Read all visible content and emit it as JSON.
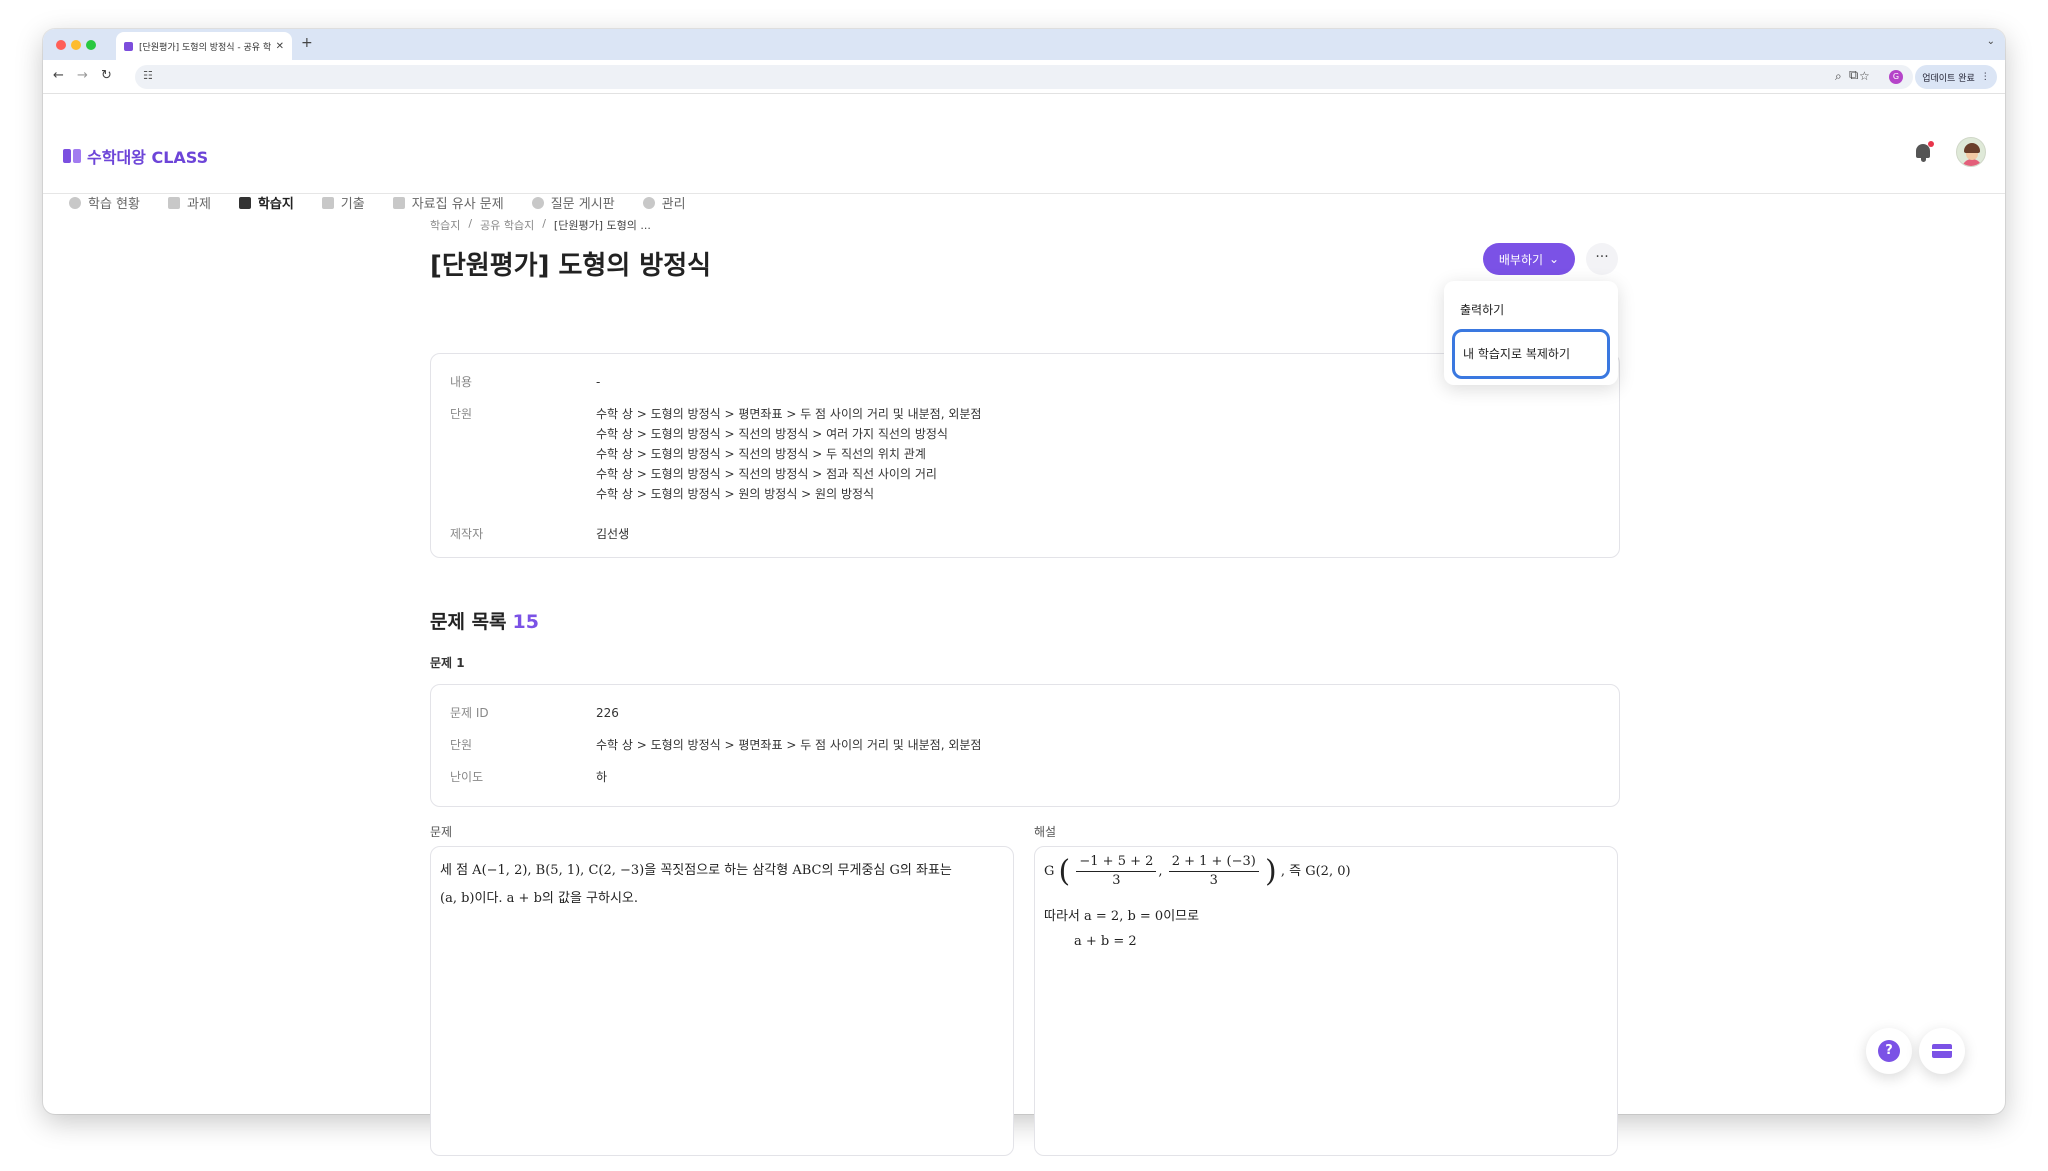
{
  "browser": {
    "tab_title": "[단원평가] 도형의 방정식 - 공유 학",
    "new_tab": "+",
    "update_label": "업데이트 완료",
    "profile_initial": "G",
    "tab_menu": "⌄"
  },
  "app": {
    "logo_text": "수학대왕 CLASS",
    "nav": [
      {
        "label": "학습 현황"
      },
      {
        "label": "과제"
      },
      {
        "label": "학습지"
      },
      {
        "label": "기출"
      },
      {
        "label": "자료집 유사 문제"
      },
      {
        "label": "질문 게시판"
      },
      {
        "label": "관리"
      }
    ]
  },
  "breadcrumb": [
    "학습지",
    "/",
    "공유 학습지",
    "/",
    "[단원평가] 도형의 ..."
  ],
  "page": {
    "title": "[단원평가] 도형의 방정식",
    "distribute_label": "배부하기",
    "more_label": "···"
  },
  "dropdown": {
    "print": "출력하기",
    "copy": "내 학습지로 복제하기"
  },
  "info": {
    "content_label": "내용",
    "content_value": "-",
    "unit_label": "단원",
    "units": [
      "수학 상 > 도형의 방정식 > 평면좌표 > 두 점 사이의 거리 및 내분점, 외분점",
      "수학 상 > 도형의 방정식 > 직선의 방정식 > 여러 가지 직선의 방정식",
      "수학 상 > 도형의 방정식 > 직선의 방정식 > 두 직선의 위치 관계",
      "수학 상 > 도형의 방정식 > 직선의 방정식 > 점과 직선 사이의 거리",
      "수학 상 > 도형의 방정식 > 원의 방정식 > 원의 방정식"
    ],
    "author_label": "제작자",
    "author_value": "김선생"
  },
  "problem_list": {
    "heading": "문제 목록",
    "count": "15",
    "problem_label": "문제 1",
    "id_label": "문제 ID",
    "id_value": "226",
    "unit_label": "단원",
    "unit_value": "수학 상 > 도형의 방정식 > 평면좌표 > 두 점 사이의 거리 및 내분점, 외분점",
    "difficulty_label": "난이도",
    "difficulty_value": "하"
  },
  "problem": {
    "label": "문제",
    "line1": "세 점 A(−1, 2), B(5, 1), C(2, −3)을 꼭짓점으로 하는 삼각형 ABC의 무게중심 G의 좌표는",
    "line2": "(a, b)이다. a + b의 값을 구하시오."
  },
  "solution": {
    "label": "해설",
    "g_prefix": "G",
    "frac1_num": "−1 + 5 + 2",
    "frac1_den": "3",
    "frac2_num": "2 + 1 + (−3)",
    "frac2_den": "3",
    "g_suffix": ", 즉 G(2, 0)",
    "line2": "따라서 a = 2, b = 0이므로",
    "line3": "a + b = 2"
  },
  "fab": {
    "help": "?"
  }
}
